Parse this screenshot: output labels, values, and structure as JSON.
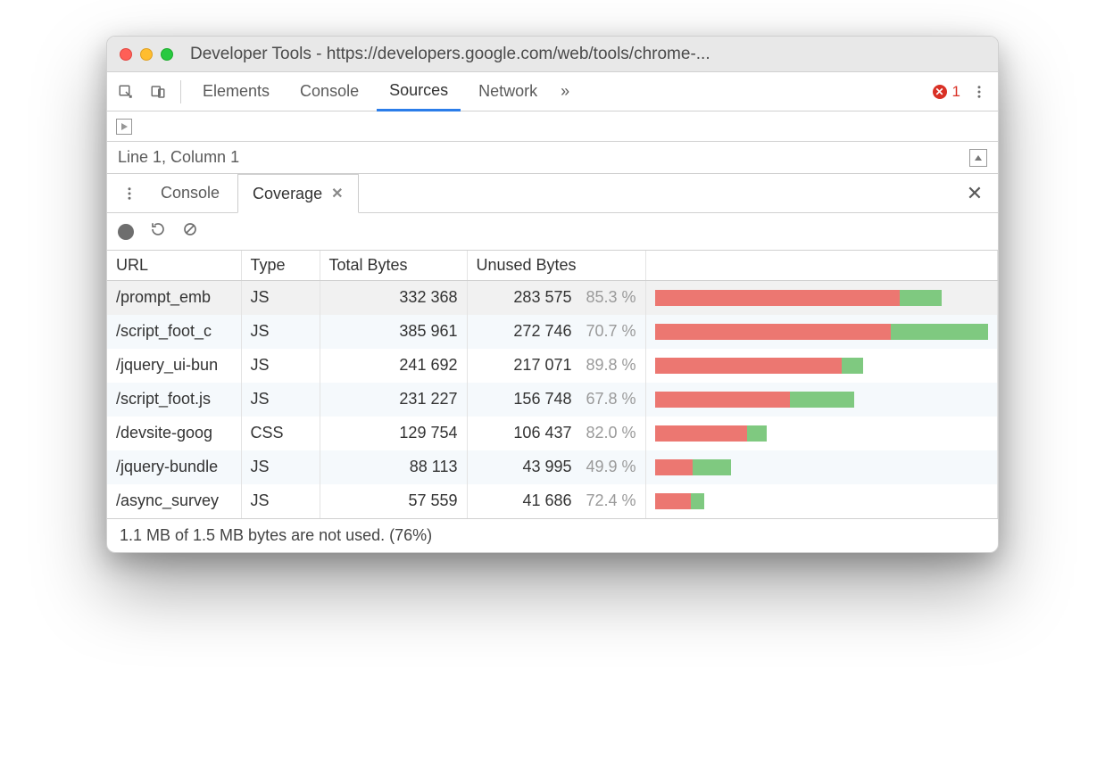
{
  "window": {
    "title": "Developer Tools - https://developers.google.com/web/tools/chrome-..."
  },
  "tabs": {
    "elements": "Elements",
    "console": "Console",
    "sources": "Sources",
    "network": "Network",
    "more": "»",
    "error_count": "1"
  },
  "sources": {
    "status": "Line 1, Column 1"
  },
  "drawer": {
    "console": "Console",
    "coverage": "Coverage"
  },
  "coverage": {
    "headers": {
      "url": "URL",
      "type": "Type",
      "total": "Total Bytes",
      "unused": "Unused Bytes"
    },
    "rows": [
      {
        "url": "/prompt_emb",
        "type": "JS",
        "total": "332 368",
        "unused": "283 575",
        "pct": "85.3 %",
        "bar_total": 86.1,
        "bar_unused": 73.4
      },
      {
        "url": "/script_foot_c",
        "type": "JS",
        "total": "385 961",
        "unused": "272 746",
        "pct": "70.7 %",
        "bar_total": 100.0,
        "bar_unused": 70.7
      },
      {
        "url": "/jquery_ui-bun",
        "type": "JS",
        "total": "241 692",
        "unused": "217 071",
        "pct": "89.8 %",
        "bar_total": 62.6,
        "bar_unused": 56.2
      },
      {
        "url": "/script_foot.js",
        "type": "JS",
        "total": "231 227",
        "unused": "156 748",
        "pct": "67.8 %",
        "bar_total": 59.9,
        "bar_unused": 40.6
      },
      {
        "url": "/devsite-goog",
        "type": "CSS",
        "total": "129 754",
        "unused": "106 437",
        "pct": "82.0 %",
        "bar_total": 33.6,
        "bar_unused": 27.6
      },
      {
        "url": "/jquery-bundle",
        "type": "JS",
        "total": "88 113",
        "unused": "43 995",
        "pct": "49.9 %",
        "bar_total": 22.8,
        "bar_unused": 11.4
      },
      {
        "url": "/async_survey",
        "type": "JS",
        "total": "57 559",
        "unused": "41 686",
        "pct": "72.4 %",
        "bar_total": 14.9,
        "bar_unused": 10.8
      }
    ],
    "footer": "1.1 MB of 1.5 MB bytes are not used. (76%)"
  }
}
